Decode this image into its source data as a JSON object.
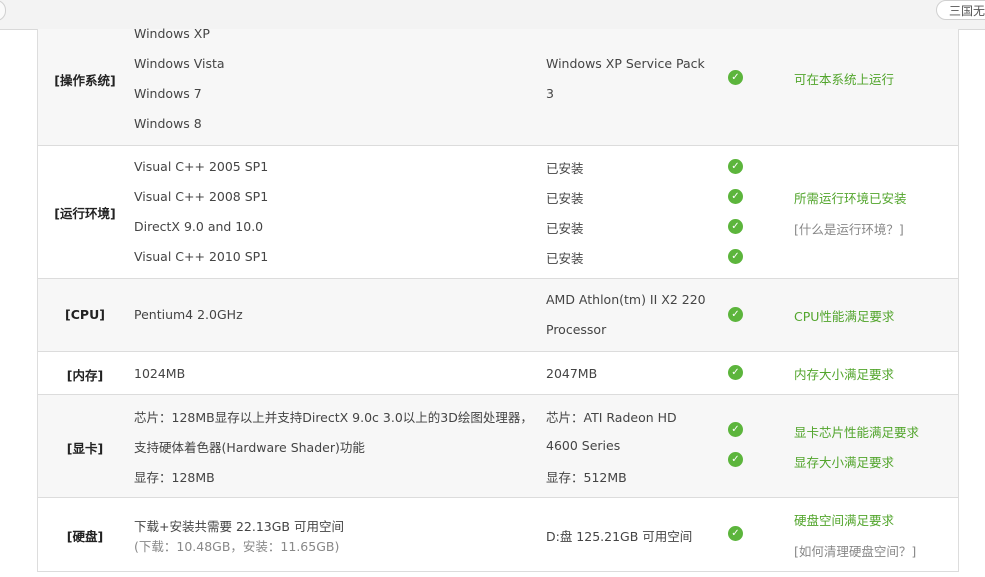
{
  "search": {
    "text": "三国无"
  },
  "rows": [
    {
      "category": "[操作系统]",
      "required": [
        "Windows XP",
        "Windows Vista",
        "Windows 7",
        "Windows 8"
      ],
      "current": [
        "Windows XP Service Pack",
        "3"
      ],
      "results": [
        "可在本系统上运行"
      ]
    },
    {
      "category": "[运行环境]",
      "required": [
        "Visual C++ 2005 SP1",
        "Visual C++ 2008 SP1",
        "DirectX 9.0 and 10.0",
        "Visual C++ 2010 SP1"
      ],
      "current": [
        "已安装",
        "已安装",
        "已安装",
        "已安装"
      ],
      "results": [
        "所需运行环境已安装"
      ],
      "help_link": "[什么是运行环境？]"
    },
    {
      "category": "[CPU]",
      "required": [
        "Pentium4 2.0GHz"
      ],
      "current": [
        "AMD Athlon(tm) II X2 220",
        "Processor"
      ],
      "results": [
        "CPU性能满足要求"
      ]
    },
    {
      "category": "[内存]",
      "required": [
        "1024MB"
      ],
      "current": [
        "2047MB"
      ],
      "results": [
        "内存大小满足要求"
      ]
    },
    {
      "category": "[显卡]",
      "required": [
        "芯片：128MB显存以上并支持DirectX 9.0c 3.0以上的3D绘图处理器，",
        "支持硬体着色器(Hardware Shader)功能",
        "显存：128MB"
      ],
      "current": [
        "芯片：ATI Radeon HD",
        "4600 Series",
        "显存：512MB"
      ],
      "results": [
        "显卡芯片性能满足要求",
        "显存大小满足要求"
      ]
    },
    {
      "category": "[硬盘]",
      "required": [
        "下载+安装共需要  22.13GB 可用空间",
        "(下载：10.48GB，安装：11.65GB)"
      ],
      "current": [
        "D:盘  125.21GB 可用空间"
      ],
      "results": [
        "硬盘空间满足要求"
      ],
      "help_link": "[如何清理硬盘空间？]"
    }
  ],
  "colors": {
    "ok": "#5cb53c",
    "result_text": "#52a52c",
    "link": "#888888"
  },
  "icons": {
    "status": "check-circle-icon"
  }
}
